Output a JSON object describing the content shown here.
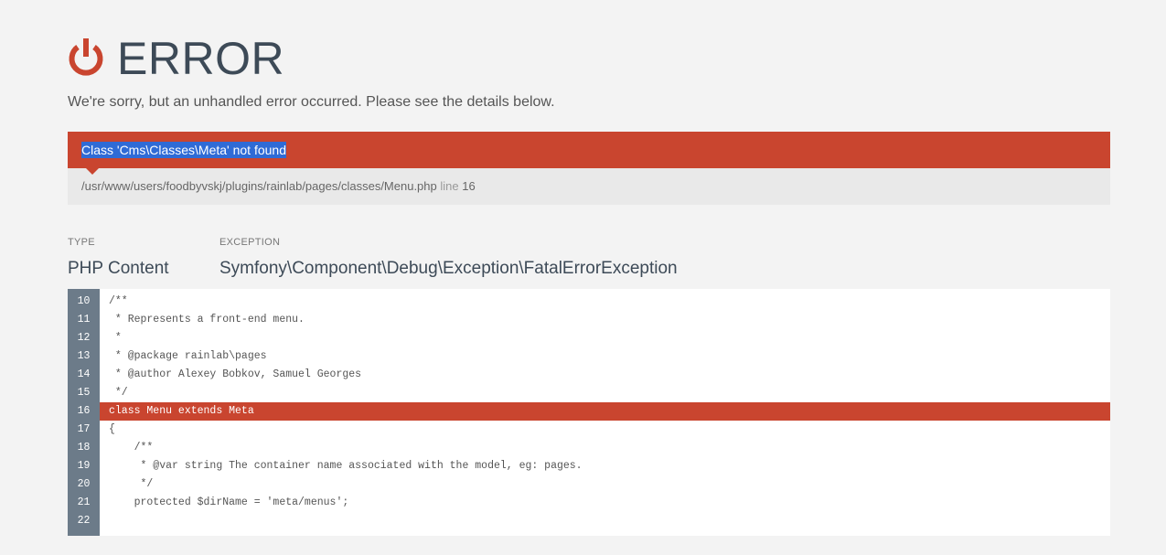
{
  "page": {
    "title": "ERROR",
    "subtitle": "We're sorry, but an unhandled error occurred. Please see the details below."
  },
  "error": {
    "message": "Class 'Cms\\Classes\\Meta' not found",
    "file": "/usr/www/users/foodbyvskj/plugins/rainlab/pages/classes/Menu.php",
    "line_label": "line",
    "line_number": "16"
  },
  "meta": {
    "type_label": "TYPE",
    "type_value": "PHP Content",
    "exception_label": "EXCEPTION",
    "exception_value": "Symfony\\Component\\Debug\\Exception\\FatalErrorException"
  },
  "code": {
    "highlight_line": 16,
    "lines": [
      {
        "num": "10",
        "text": "/**"
      },
      {
        "num": "11",
        "text": " * Represents a front-end menu."
      },
      {
        "num": "12",
        "text": " *"
      },
      {
        "num": "13",
        "text": " * @package rainlab\\pages"
      },
      {
        "num": "14",
        "text": " * @author Alexey Bobkov, Samuel Georges"
      },
      {
        "num": "15",
        "text": " */"
      },
      {
        "num": "16",
        "text": "class Menu extends Meta"
      },
      {
        "num": "17",
        "text": "{"
      },
      {
        "num": "18",
        "text": "    /**"
      },
      {
        "num": "19",
        "text": "     * @var string The container name associated with the model, eg: pages."
      },
      {
        "num": "20",
        "text": "     */"
      },
      {
        "num": "21",
        "text": "    protected $dirName = 'meta/menus';"
      },
      {
        "num": "22",
        "text": ""
      }
    ]
  },
  "colors": {
    "accent": "#c9452f",
    "selection": "#2f6bd6",
    "gutter": "#6c7b89"
  }
}
